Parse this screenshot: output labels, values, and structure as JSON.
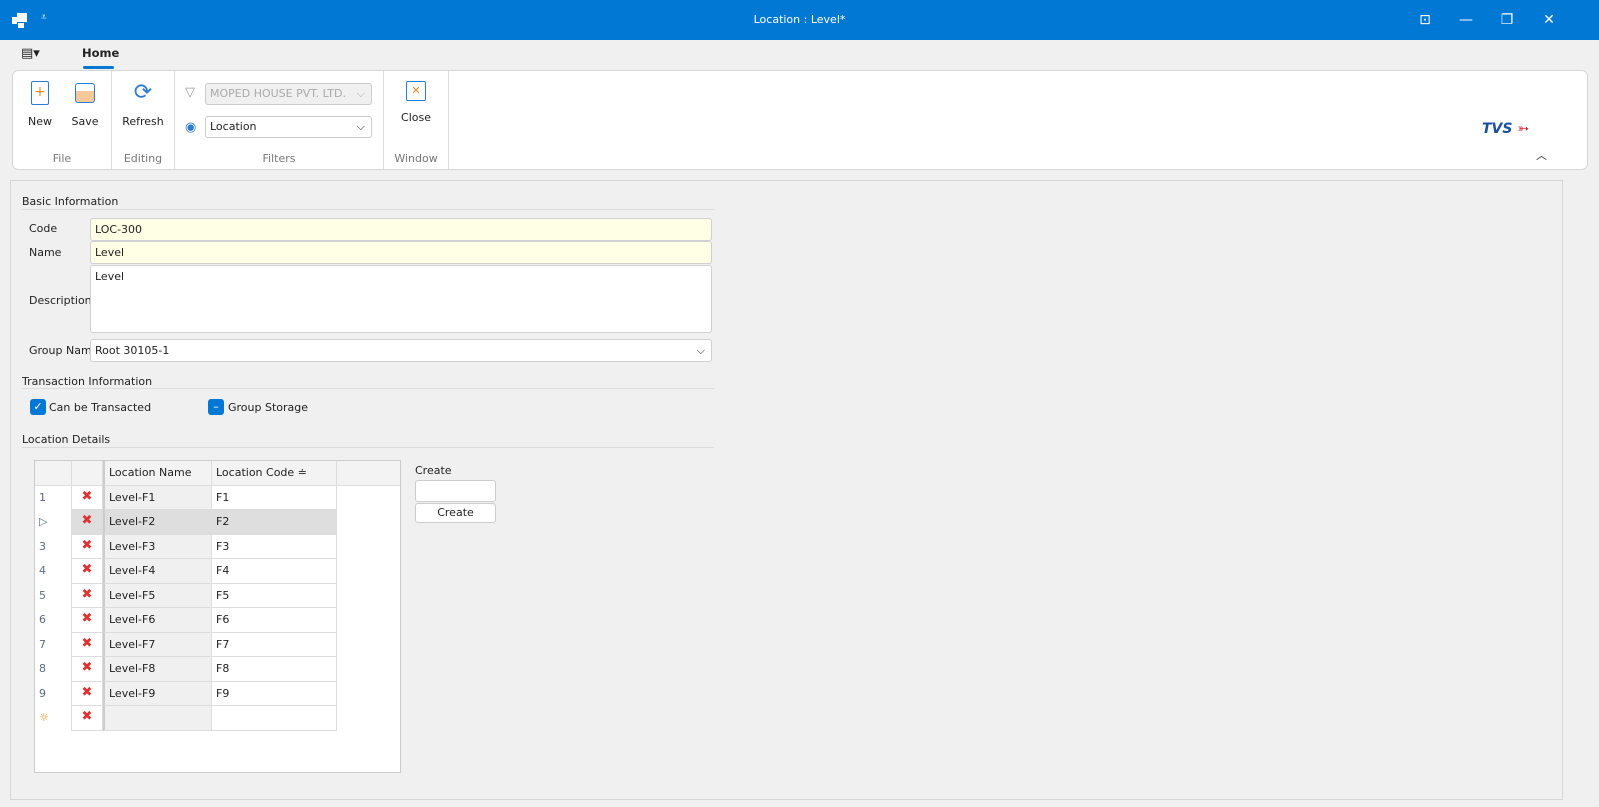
{
  "window": {
    "title": "Location : Level*",
    "accent": "#0078d4"
  },
  "ribbon": {
    "tab": "Home",
    "file": {
      "label": "File",
      "new": "New",
      "save": "Save"
    },
    "editing": {
      "label": "Editing",
      "refresh": "Refresh"
    },
    "filters": {
      "label": "Filters",
      "company": "MOPED HOUSE PVT. LTD.",
      "view": "Location"
    },
    "window": {
      "label": "Window",
      "close": "Close"
    },
    "logo": "TVS"
  },
  "basic": {
    "title": "Basic Information",
    "code_label": "Code",
    "code": "LOC-300",
    "name_label": "Name",
    "name": "Level",
    "desc_label": "Description",
    "desc": "Level",
    "group_label": "Group Name",
    "group": "Root 30105-1"
  },
  "transaction": {
    "title": "Transaction Information",
    "can_transact": "Can be Transacted",
    "can_transact_checked": true,
    "group_storage": "Group Storage",
    "group_storage_state": "indeterminate"
  },
  "details": {
    "title": "Location Details",
    "columns": [
      "Location Name",
      "Location Code"
    ],
    "rows": [
      {
        "n": "1",
        "name": "Level-F1",
        "code": "F1"
      },
      {
        "n": "▷",
        "name": "Level-F2",
        "code": "F2"
      },
      {
        "n": "3",
        "name": "Level-F3",
        "code": "F3"
      },
      {
        "n": "4",
        "name": "Level-F4",
        "code": "F4"
      },
      {
        "n": "5",
        "name": "Level-F5",
        "code": "F5"
      },
      {
        "n": "6",
        "name": "Level-F6",
        "code": "F6"
      },
      {
        "n": "7",
        "name": "Level-F7",
        "code": "F7"
      },
      {
        "n": "8",
        "name": "Level-F8",
        "code": "F8"
      },
      {
        "n": "9",
        "name": "Level-F9",
        "code": "F9"
      },
      {
        "n": "☼",
        "name": "",
        "code": ""
      }
    ],
    "create_label": "Create",
    "create_value": "",
    "create_button": "Create"
  }
}
